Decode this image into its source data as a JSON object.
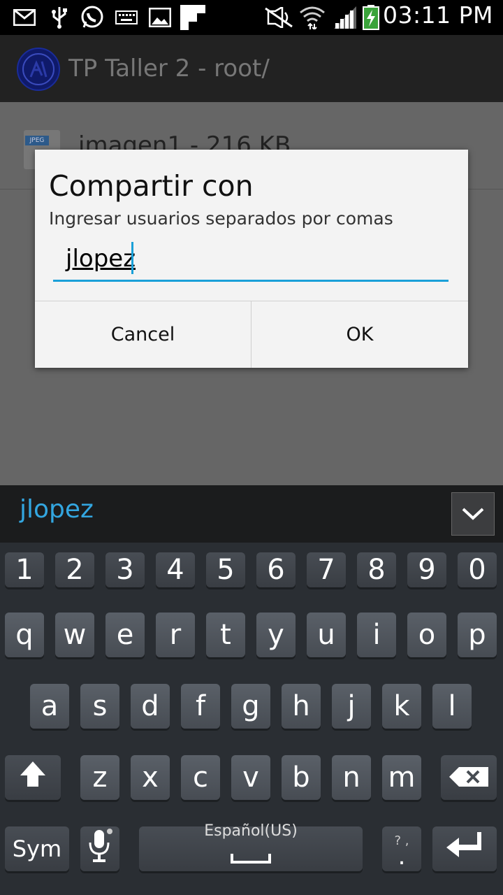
{
  "status_bar": {
    "time": "03:11 PM",
    "icons": [
      "mail-icon",
      "usb-icon",
      "whatsapp-icon",
      "keyboard-icon",
      "image-icon",
      "flipboard-icon",
      "mute-icon",
      "wifi-icon",
      "signal-icon",
      "battery-icon"
    ]
  },
  "action_bar": {
    "title": "TP Taller 2 - root/"
  },
  "file_list": [
    {
      "badge": "JPEG",
      "name": "imagen1 - 216 KB"
    }
  ],
  "dialog": {
    "title": "Compartir con",
    "message": "Ingresar usuarios separados por comas",
    "input_value": "jlopez",
    "cancel_label": "Cancel",
    "ok_label": "OK",
    "accent": "#1aa0d8"
  },
  "suggestion_bar": {
    "word": "jlopez",
    "accent": "#33a6e0"
  },
  "keyboard": {
    "numbers": [
      "1",
      "2",
      "3",
      "4",
      "5",
      "6",
      "7",
      "8",
      "9",
      "0"
    ],
    "row1": [
      "q",
      "w",
      "e",
      "r",
      "t",
      "y",
      "u",
      "i",
      "o",
      "p"
    ],
    "row2": [
      "a",
      "s",
      "d",
      "f",
      "g",
      "h",
      "j",
      "k",
      "l"
    ],
    "row3": [
      "z",
      "x",
      "c",
      "v",
      "b",
      "n",
      "m"
    ],
    "sym_label": "Sym",
    "space_label": "Español(US)",
    "punct_label": ".",
    "punct_hint": "? ,"
  }
}
